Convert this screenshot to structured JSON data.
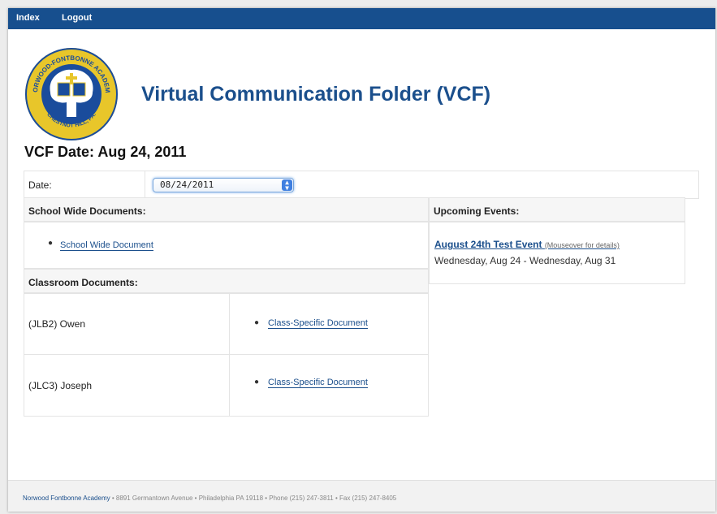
{
  "nav": {
    "index_label": "Index",
    "logout_label": "Logout"
  },
  "header": {
    "title": "Virtual Communication Folder (VCF)"
  },
  "logo": {
    "top_text": "NORWOOD-FONTBONNE ACADEMY",
    "bottom_text": "CHESTNUT HILL, PA."
  },
  "vcf_date": "VCF Date: Aug 24, 2011",
  "date_filter": {
    "label": "Date:",
    "selected": "08/24/2011"
  },
  "school_wide": {
    "heading": "School Wide Documents:",
    "documents": [
      "School Wide Document"
    ]
  },
  "classroom": {
    "heading": "Classroom Documents:",
    "rows": [
      {
        "class_name": "(JLB2) Owen",
        "document": "Class-Specific Document"
      },
      {
        "class_name": "(JLC3) Joseph",
        "document": "Class-Specific Document"
      }
    ]
  },
  "events": {
    "heading": "Upcoming Events:",
    "items": [
      {
        "title": "August 24th Test Event",
        "note": "(Mouseover for details)",
        "dates": "Wednesday, Aug 24 - Wednesday, Aug 31"
      }
    ]
  },
  "footer": {
    "school_name": "Norwood Fontbonne Academy",
    "address": " • 8891 Germantown Avenue • Philadelphia PA 19118 • Phone (215) 247-3811 • Fax (215) 247-8405"
  },
  "colors": {
    "nav_bar": "#174f8e",
    "title": "#1b4f8c",
    "link": "#1b4f8c",
    "logo_gold": "#e8c62a",
    "logo_blue": "#1a4c9c"
  }
}
